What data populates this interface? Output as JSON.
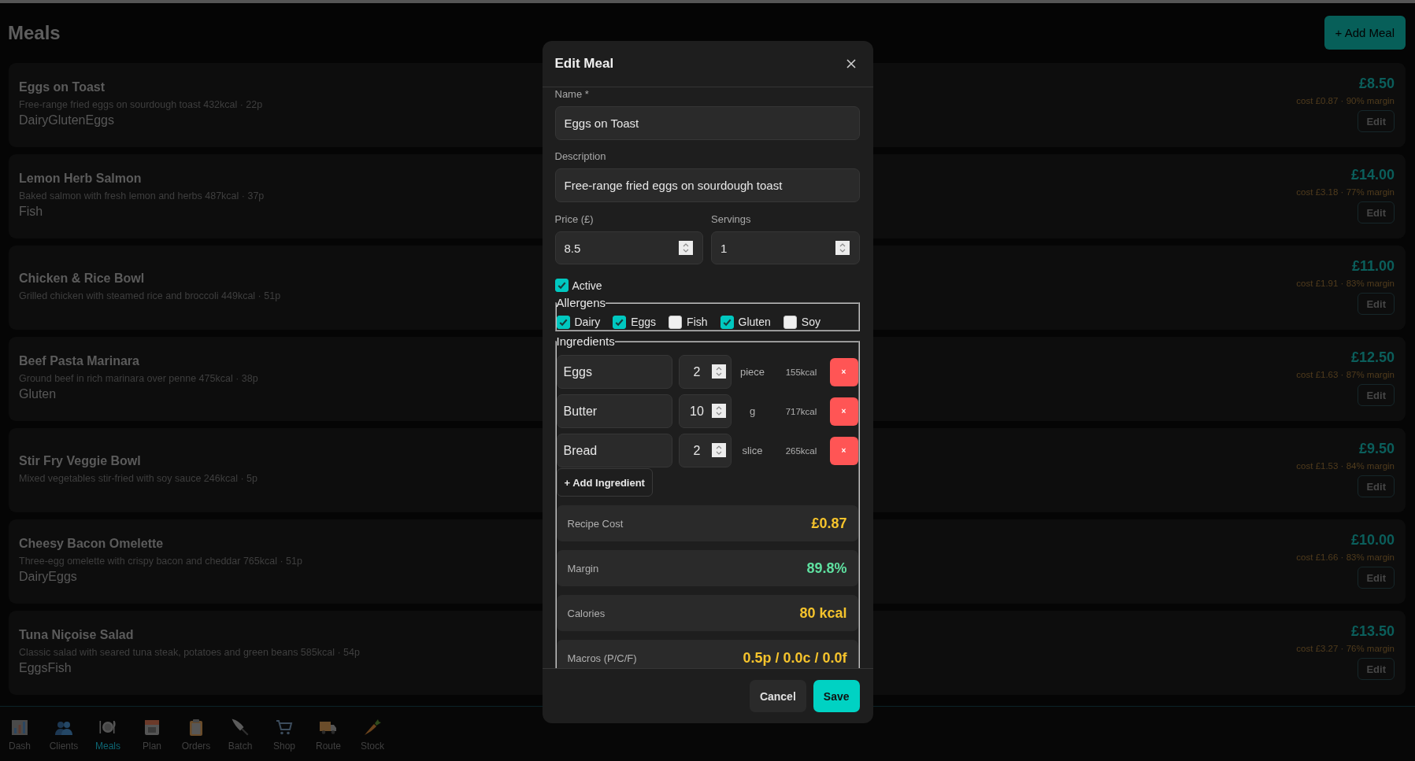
{
  "page": {
    "title": "Meals",
    "add_button": "+ Add Meal"
  },
  "meals": [
    {
      "name": "Eggs on Toast",
      "subtitle": "Free-range fried eggs on sourdough toast 432kcal · 22p",
      "allergens": [
        "Dairy",
        "Gluten",
        "Eggs"
      ],
      "price": "£8.50",
      "cost_line": "cost £0.87 · 90% margin",
      "edit_button": "Edit"
    },
    {
      "name": "Lemon Herb Salmon",
      "subtitle": "Baked salmon with fresh lemon and herbs 487kcal · 37p",
      "allergens": [
        "Fish"
      ],
      "price": "£14.00",
      "cost_line": "cost £3.18 · 77% margin",
      "edit_button": "Edit"
    },
    {
      "name": "Chicken & Rice Bowl",
      "subtitle": "Grilled chicken with steamed rice and broccoli 449kcal · 51p",
      "price": "£11.00",
      "cost_line": "cost £1.91 · 83% margin",
      "edit_button": "Edit"
    },
    {
      "name": "Beef Pasta Marinara",
      "subtitle": "Ground beef in rich marinara over penne 475kcal · 38p",
      "allergens": [
        "Gluten"
      ],
      "price": "£12.50",
      "cost_line": "cost £1.63 · 87% margin",
      "edit_button": "Edit"
    },
    {
      "name": "Stir Fry Veggie Bowl",
      "subtitle": "Mixed vegetables stir-fried with soy sauce 246kcal · 5p",
      "price": "£9.50",
      "cost_line": "cost £1.53 · 84% margin",
      "edit_button": "Edit"
    },
    {
      "name": "Cheesy Bacon Omelette",
      "subtitle": "Three-egg omelette with crispy bacon and cheddar 765kcal · 51p",
      "allergens": [
        "Dairy",
        "Eggs"
      ],
      "price": "£10.00",
      "cost_line": "cost £1.66 · 83% margin",
      "edit_button": "Edit"
    },
    {
      "name": "Tuna Niçoise Salad",
      "subtitle": "Classic salad with seared tuna steak, potatoes and green beans 585kcal · 54p",
      "allergens": [
        "Eggs",
        "Fish"
      ],
      "price": "£13.50",
      "cost_line": "cost £3.27 · 76% margin",
      "edit_button": "Edit"
    }
  ],
  "dialog": {
    "title": "Edit Meal",
    "fields": [
      {
        "label": "Name *",
        "value": "Eggs on Toast"
      },
      {
        "label": "Description",
        "value": "Free-range fried eggs on sourdough toast"
      }
    ],
    "number_fields": [
      {
        "label": "Price (£)",
        "value": "8.5"
      },
      {
        "label": "Servings",
        "value": "1"
      }
    ],
    "active": {
      "label": "Active",
      "checked": true
    },
    "allergens": {
      "legend": "Allergens",
      "items": [
        {
          "label": "Dairy",
          "checked": true
        },
        {
          "label": "Eggs",
          "checked": true
        },
        {
          "label": "Fish",
          "checked": false
        },
        {
          "label": "Gluten",
          "checked": true
        },
        {
          "label": "Soy",
          "checked": false
        }
      ]
    },
    "ingredients": {
      "legend": "Ingredients",
      "rows": [
        {
          "name": "Eggs",
          "quantity": "2",
          "unit": "piece",
          "calories": "155kcal",
          "remove_label": "×"
        },
        {
          "name": "Butter",
          "quantity": "10",
          "unit": "g",
          "calories": "717kcal",
          "remove_label": "×"
        },
        {
          "name": "Bread",
          "quantity": "2",
          "unit": "slice",
          "calories": "265kcal",
          "remove_label": "×"
        }
      ],
      "add_button": "+ Add Ingredient",
      "summary": [
        {
          "label": "Recipe Cost",
          "value": "£0.87",
          "color": "#f5c32c"
        },
        {
          "label": "Margin",
          "value": "89.8%",
          "color": "#5fe0a0"
        },
        {
          "label": "Calories",
          "value": "80 kcal",
          "color": "#f5c32c"
        },
        {
          "label": "Macros (P/C/F)",
          "value": "0.5p / 0.0c / 0.0f",
          "color": "#f5c32c"
        }
      ]
    },
    "buttons": {
      "cancel": "Cancel",
      "save": "Save"
    }
  },
  "nav": [
    {
      "label": "Dash",
      "selected": false
    },
    {
      "label": "Clients",
      "selected": false
    },
    {
      "label": "Meals",
      "selected": true
    },
    {
      "label": "Plan",
      "selected": false
    },
    {
      "label": "Orders",
      "selected": false
    },
    {
      "label": "Batch",
      "selected": false
    },
    {
      "label": "Shop",
      "selected": false
    },
    {
      "label": "Route",
      "selected": false
    },
    {
      "label": "Stock",
      "selected": false
    }
  ]
}
